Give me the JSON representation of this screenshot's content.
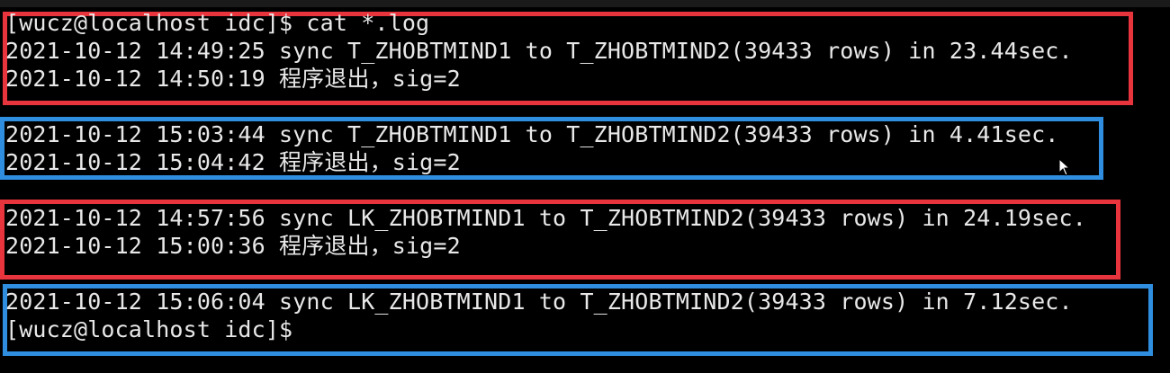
{
  "terminal": {
    "lines": [
      "[wucz@localhost idc]$ cat *.log",
      "2021-10-12 14:49:25 sync T_ZHOBTMIND1 to T_ZHOBTMIND2(39433 rows) in 23.44sec.",
      "2021-10-12 14:50:19 程序退出，sig=2",
      "2021-10-12 15:03:44 sync T_ZHOBTMIND1 to T_ZHOBTMIND2(39433 rows) in 4.41sec.",
      "2021-10-12 15:04:42 程序退出，sig=2",
      "2021-10-12 14:57:56 sync LK_ZHOBTMIND1 to T_ZHOBTMIND2(39433 rows) in 24.19sec.",
      "2021-10-12 15:00:36 程序退出，sig=2",
      "2021-10-12 15:06:04 sync LK_ZHOBTMIND1 to T_ZHOBTMIND2(39433 rows) in 7.12sec.",
      "[wucz@localhost idc]$"
    ]
  },
  "colors": {
    "text": "#e8e8e8",
    "background": "#000000",
    "highlight_red": "#e8343c",
    "highlight_blue": "#2f8ee0"
  },
  "icons": {
    "cursor": "mouse-pointer-icon"
  }
}
